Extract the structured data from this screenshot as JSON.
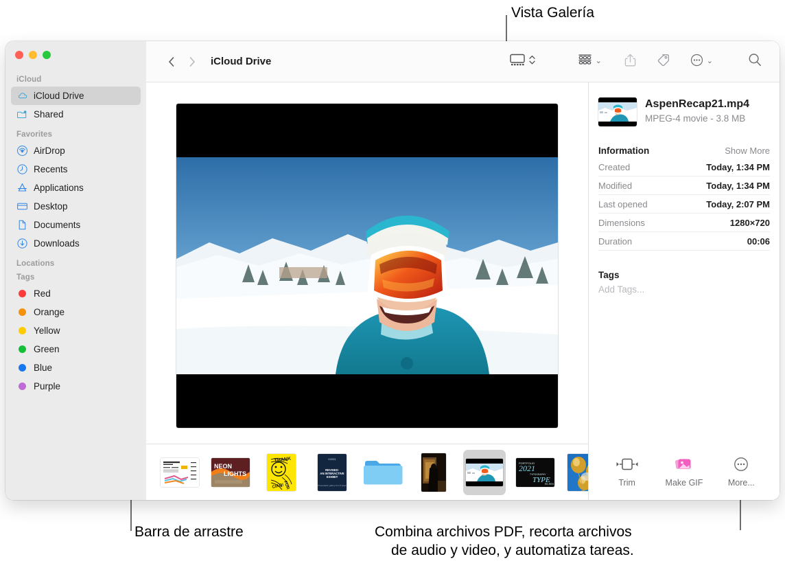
{
  "annotations": [
    {
      "id": "gallery-view",
      "text": "Vista Galería"
    },
    {
      "id": "drag-bar",
      "text": "Barra de arrastre"
    },
    {
      "id": "quick-actions-line1",
      "text": "Combina archivos PDF, recorta archivos"
    },
    {
      "id": "quick-actions-line2",
      "text": "de audio y video, y automatiza tareas."
    }
  ],
  "window": {
    "traffic_lights": [
      {
        "name": "close",
        "color": "#ff5f57"
      },
      {
        "name": "minimize",
        "color": "#febc2e"
      },
      {
        "name": "zoom",
        "color": "#28c840"
      }
    ]
  },
  "sidebar": {
    "sections": [
      {
        "title": "iCloud",
        "items": [
          {
            "label": "iCloud Drive",
            "icon": "cloud-icon",
            "selected": true
          },
          {
            "label": "Shared",
            "icon": "shared-folder-icon",
            "selected": false
          }
        ]
      },
      {
        "title": "Favorites",
        "items": [
          {
            "label": "AirDrop",
            "icon": "airdrop-icon",
            "selected": false
          },
          {
            "label": "Recents",
            "icon": "clock-icon",
            "selected": false
          },
          {
            "label": "Applications",
            "icon": "applications-icon",
            "selected": false
          },
          {
            "label": "Desktop",
            "icon": "desktop-icon",
            "selected": false
          },
          {
            "label": "Documents",
            "icon": "document-icon",
            "selected": false
          },
          {
            "label": "Downloads",
            "icon": "downloads-icon",
            "selected": false
          }
        ]
      },
      {
        "title": "Locations",
        "items": []
      },
      {
        "title": "Tags",
        "items": [
          {
            "label": "Red",
            "icon": "tag-dot-icon",
            "color": "#fc3b3b"
          },
          {
            "label": "Orange",
            "icon": "tag-dot-icon",
            "color": "#f5920b"
          },
          {
            "label": "Yellow",
            "icon": "tag-dot-icon",
            "color": "#ffcc00"
          },
          {
            "label": "Green",
            "icon": "tag-dot-icon",
            "color": "#14c038"
          },
          {
            "label": "Blue",
            "icon": "tag-dot-icon",
            "color": "#1878f0"
          },
          {
            "label": "Purple",
            "icon": "tag-dot-icon",
            "color": "#c06ad6"
          }
        ]
      }
    ]
  },
  "toolbar": {
    "back_icon": "chevron-left-icon",
    "forward_icon": "chevron-right-icon",
    "path_label": "iCloud Drive",
    "view_icon": "gallery-view-icon",
    "view_stepper_icon": "chevron-updown-icon",
    "group_icon": "group-items-icon",
    "group_chevron": "⌄",
    "share_icon": "share-icon",
    "tag_icon": "tag-icon",
    "action_icon": "more-actions-icon",
    "action_chevron": "⌄",
    "search_icon": "search-icon"
  },
  "preview": {
    "media_alt": "snowboarder-preview"
  },
  "filmstrip": {
    "items": [
      {
        "name": "poster-infographic",
        "selected": false
      },
      {
        "name": "neon-lights-poster",
        "selected": false
      },
      {
        "name": "thank-you-ciao-poster",
        "selected": false
      },
      {
        "name": "revised-interactive-exhibit-poster",
        "selected": false
      },
      {
        "name": "blue-folder",
        "selected": false
      },
      {
        "name": "dark-interior-photo",
        "selected": false
      },
      {
        "name": "aspen-recap-video",
        "selected": true
      },
      {
        "name": "portfolio-2021-type-poster",
        "selected": false
      },
      {
        "name": "gold-balloons-photo",
        "selected": false
      }
    ]
  },
  "inspector": {
    "file_name": "AspenRecap21.mp4",
    "file_meta": "MPEG-4 movie - 3.8 MB",
    "information": {
      "title": "Information",
      "action": "Show More",
      "rows": [
        {
          "key": "Created",
          "value": "Today, 1:34 PM"
        },
        {
          "key": "Modified",
          "value": "Today, 1:34 PM"
        },
        {
          "key": "Last opened",
          "value": "Today, 2:07 PM"
        },
        {
          "key": "Dimensions",
          "value": "1280×720"
        },
        {
          "key": "Duration",
          "value": "00:06"
        }
      ]
    },
    "tags": {
      "title": "Tags",
      "placeholder": "Add Tags..."
    },
    "quick_actions": [
      {
        "label": "Trim",
        "icon": "trim-icon"
      },
      {
        "label": "Make GIF",
        "icon": "make-gif-icon"
      },
      {
        "label": "More...",
        "icon": "more-circle-icon"
      }
    ]
  }
}
